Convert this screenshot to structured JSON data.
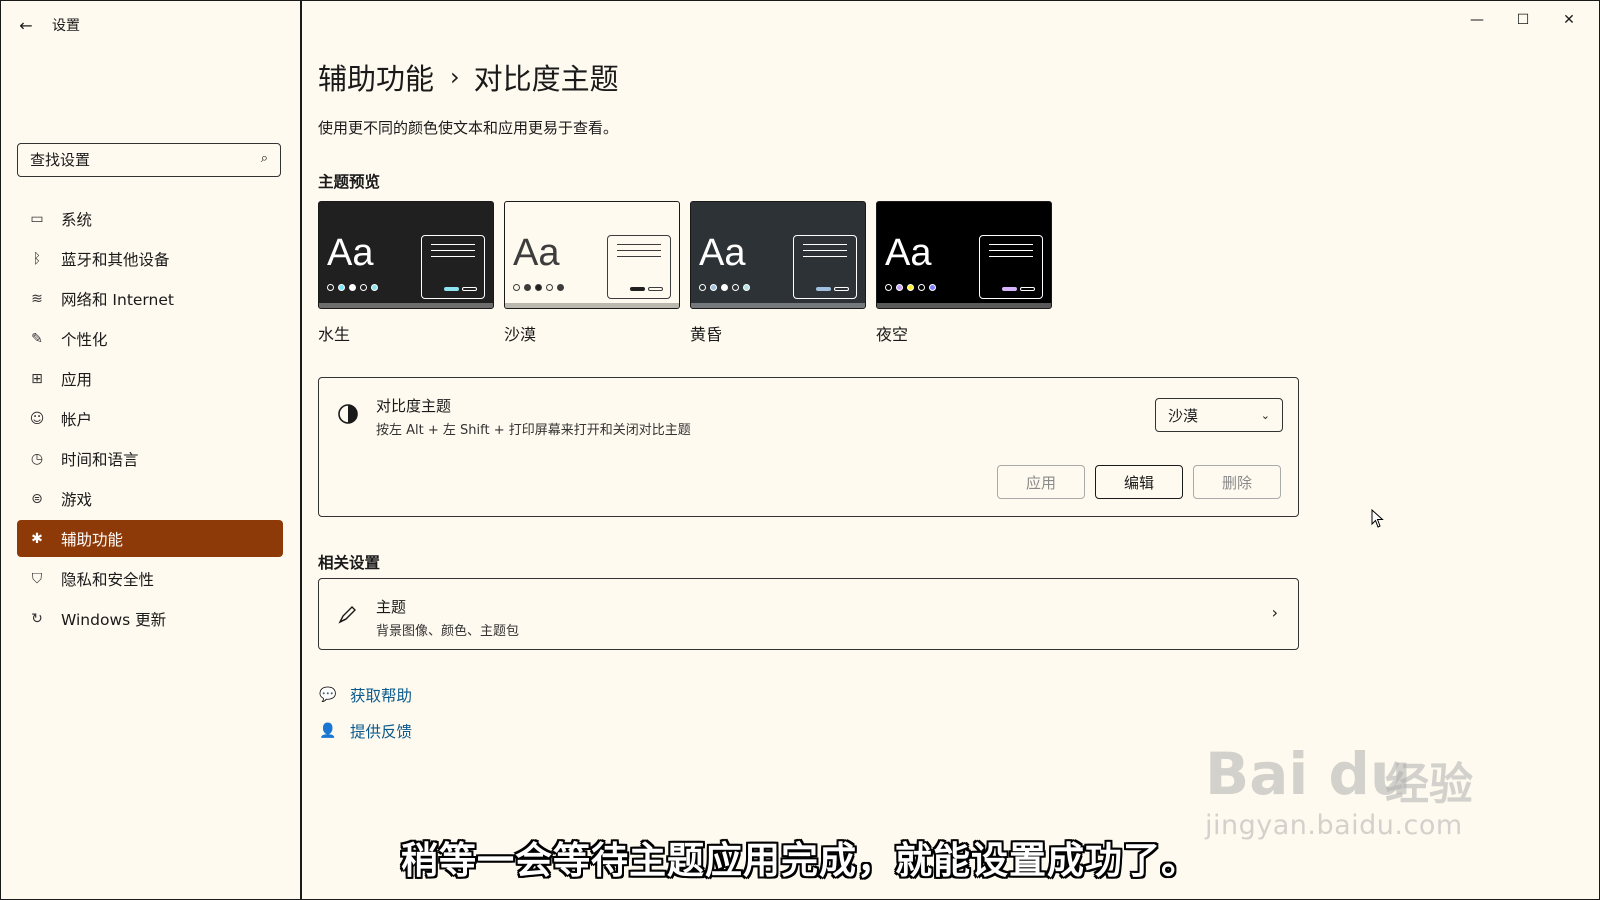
{
  "app": {
    "title": "设置",
    "back_icon": "←"
  },
  "window_controls": {
    "minimize": "—",
    "maximize": "☐",
    "close": "✕"
  },
  "sidebar": {
    "search_placeholder": "查找设置",
    "items": [
      {
        "label": "系统",
        "icon": "monitor-icon"
      },
      {
        "label": "蓝牙和其他设备",
        "icon": "bluetooth-icon"
      },
      {
        "label": "网络和 Internet",
        "icon": "wifi-icon"
      },
      {
        "label": "个性化",
        "icon": "brush-icon"
      },
      {
        "label": "应用",
        "icon": "apps-icon"
      },
      {
        "label": "帐户",
        "icon": "person-icon"
      },
      {
        "label": "时间和语言",
        "icon": "clock-language-icon"
      },
      {
        "label": "游戏",
        "icon": "gamepad-icon"
      },
      {
        "label": "辅助功能",
        "icon": "accessibility-icon",
        "active": true
      },
      {
        "label": "隐私和安全性",
        "icon": "shield-icon"
      },
      {
        "label": "Windows 更新",
        "icon": "update-icon"
      }
    ]
  },
  "main": {
    "breadcrumb": {
      "parent": "辅助功能",
      "separator": "›",
      "current": "对比度主题"
    },
    "description": "使用更不同的颜色使文本和应用更易于查看。",
    "preview_label": "主题预览",
    "themes": [
      {
        "name": "水生",
        "aa": "Aa",
        "bg": "#202020",
        "fg": "#ffffff",
        "dots": [
          "#202020",
          "#75e9fc",
          "#ffffff",
          "#202020",
          "#8ee3f0"
        ],
        "b1": "#8ee3f0",
        "b2": "#202020"
      },
      {
        "name": "沙漠",
        "aa": "Aa",
        "bg": "#fffaef",
        "fg": "#3d3d3d",
        "dots": [
          "#fffaef",
          "#3d3d3d",
          "#202020",
          "#fffaef",
          "#3d3d3d"
        ],
        "b1": "#202020",
        "b2": "#fffaef"
      },
      {
        "name": "黄昏",
        "aa": "Aa",
        "bg": "#2d3236",
        "fg": "#ffffff",
        "dots": [
          "#2d3236",
          "#a1bfde",
          "#ffffff",
          "#2d3236",
          "#b5e0e6"
        ],
        "b1": "#a1bfde",
        "b2": "#2d3236"
      },
      {
        "name": "夜空",
        "aa": "Aa",
        "bg": "#000000",
        "fg": "#ffffff",
        "dots": [
          "#000000",
          "#c6a0ff",
          "#ffee32",
          "#000000",
          "#8080ff"
        ],
        "b1": "#d6b4fd",
        "b2": "#000000"
      }
    ],
    "contrast_card": {
      "icon": "contrast-icon",
      "title": "对比度主题",
      "subtitle": "按左 Alt + 左 Shift + 打印屏幕来打开和关闭对比主题",
      "selected": "沙漠",
      "buttons": {
        "apply": "应用",
        "edit": "编辑",
        "delete": "删除"
      }
    },
    "related_label": "相关设置",
    "related_item": {
      "icon": "brush-icon",
      "title": "主题",
      "subtitle": "背景图像、颜色、主题包"
    },
    "links": {
      "help": "获取帮助",
      "feedback": "提供反馈"
    }
  },
  "caption": "稍等一会等待主题应用完成，就能设置成功了。",
  "watermark": {
    "logo": "Bai du",
    "cn": "经验",
    "url": "jingyan.baidu.com"
  },
  "colors": {
    "accent": "#8e3a08",
    "background": "#fffaf0",
    "link": "#0a5a8c"
  }
}
